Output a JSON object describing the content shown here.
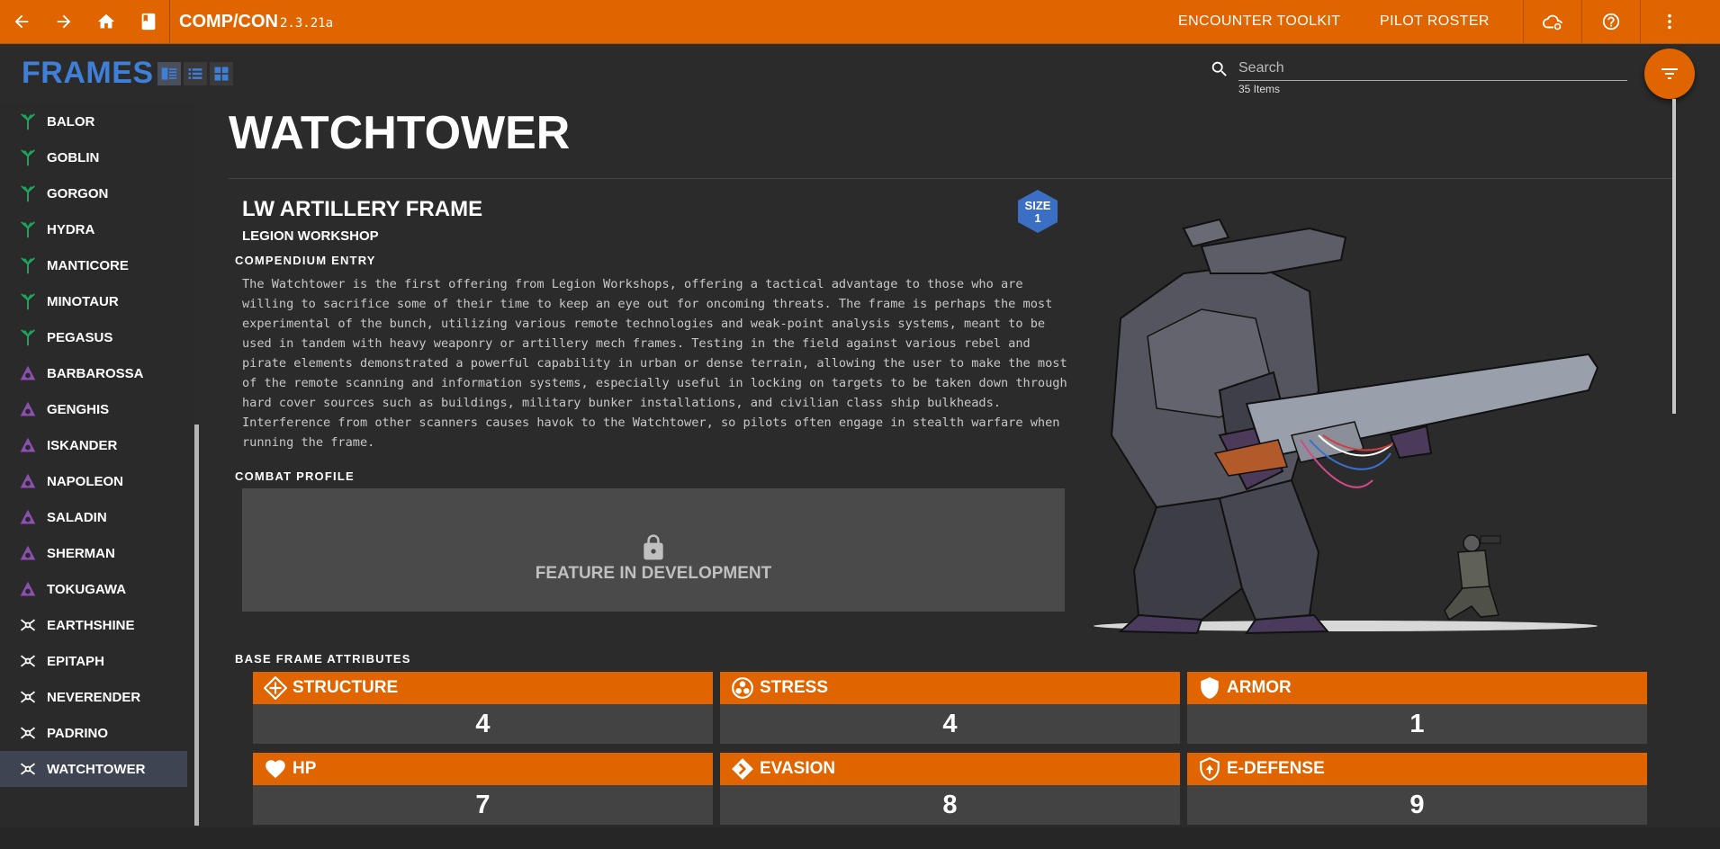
{
  "topbar": {
    "brand_name": "COMP/CON",
    "version": "2.3.21a",
    "links": [
      "ENCOUNTER TOOLKIT",
      "PILOT ROSTER"
    ]
  },
  "header": {
    "title": "FRAMES",
    "search_placeholder": "Search",
    "item_count": "35 Items"
  },
  "sidebar": {
    "items": [
      {
        "label": "BALOR",
        "group": "horus"
      },
      {
        "label": "GOBLIN",
        "group": "horus"
      },
      {
        "label": "GORGON",
        "group": "horus"
      },
      {
        "label": "HYDRA",
        "group": "horus"
      },
      {
        "label": "MANTICORE",
        "group": "horus"
      },
      {
        "label": "MINOTAUR",
        "group": "horus"
      },
      {
        "label": "PEGASUS",
        "group": "horus"
      },
      {
        "label": "BARBAROSSA",
        "group": "harrison"
      },
      {
        "label": "GENGHIS",
        "group": "harrison"
      },
      {
        "label": "ISKANDER",
        "group": "harrison"
      },
      {
        "label": "NAPOLEON",
        "group": "harrison"
      },
      {
        "label": "SALADIN",
        "group": "harrison"
      },
      {
        "label": "SHERMAN",
        "group": "harrison"
      },
      {
        "label": "TOKUGAWA",
        "group": "harrison"
      },
      {
        "label": "EARTHSHINE",
        "group": "legion"
      },
      {
        "label": "EPITAPH",
        "group": "legion"
      },
      {
        "label": "NEVERENDER",
        "group": "legion"
      },
      {
        "label": "PADRINO",
        "group": "legion"
      },
      {
        "label": "WATCHTOWER",
        "group": "legion"
      }
    ],
    "selected": "WATCHTOWER",
    "icon_colors": {
      "horus": "#1fa35a",
      "harrison": "#8a4fb0",
      "legion": "#ffffff"
    }
  },
  "main": {
    "title": "WATCHTOWER",
    "frame_type": "LW ARTILLERY FRAME",
    "manufacturer": "LEGION WORKSHOP",
    "size_label": "SIZE",
    "size_value": "1",
    "compendium_label": "COMPENDIUM ENTRY",
    "description": "The Watchtower is the first offering from Legion Workshops, offering a tactical advantage to those who are willing to sacrifice some of their time to keep an eye out for oncoming threats. The frame is perhaps the most experimental of the bunch, utilizing various remote technologies and weak-point analysis systems, meant to be used in tandem with heavy weaponry or artillery mech frames. Testing in the field against various rebel and pirate elements demonstrated a powerful capability in urban or dense terrain, allowing the user to make the most of the remote scanning and information systems, especially useful in locking on targets to be taken down through hard cover sources such as buildings, military bunker installations, and civilian class ship bulkheads. Interference from other scanners causes havok to the Watchtower, so pilots often engage in stealth warfare when running the frame.",
    "combat_label": "COMBAT PROFILE",
    "dev_notice": "FEATURE IN DEVELOPMENT",
    "attributes_label": "BASE FRAME ATTRIBUTES",
    "attributes": [
      {
        "name": "STRUCTURE",
        "value": "4",
        "icon": "structure-icon"
      },
      {
        "name": "STRESS",
        "value": "4",
        "icon": "stress-icon"
      },
      {
        "name": "ARMOR",
        "value": "1",
        "icon": "armor-icon"
      },
      {
        "name": "HP",
        "value": "7",
        "icon": "hp-icon"
      },
      {
        "name": "EVASION",
        "value": "8",
        "icon": "evasion-icon"
      },
      {
        "name": "E-DEFENSE",
        "value": "9",
        "icon": "edefense-icon"
      }
    ]
  },
  "colors": {
    "accent": "#e06500",
    "brand_blue": "#3f7fd8",
    "background": "#2b2b2b"
  }
}
